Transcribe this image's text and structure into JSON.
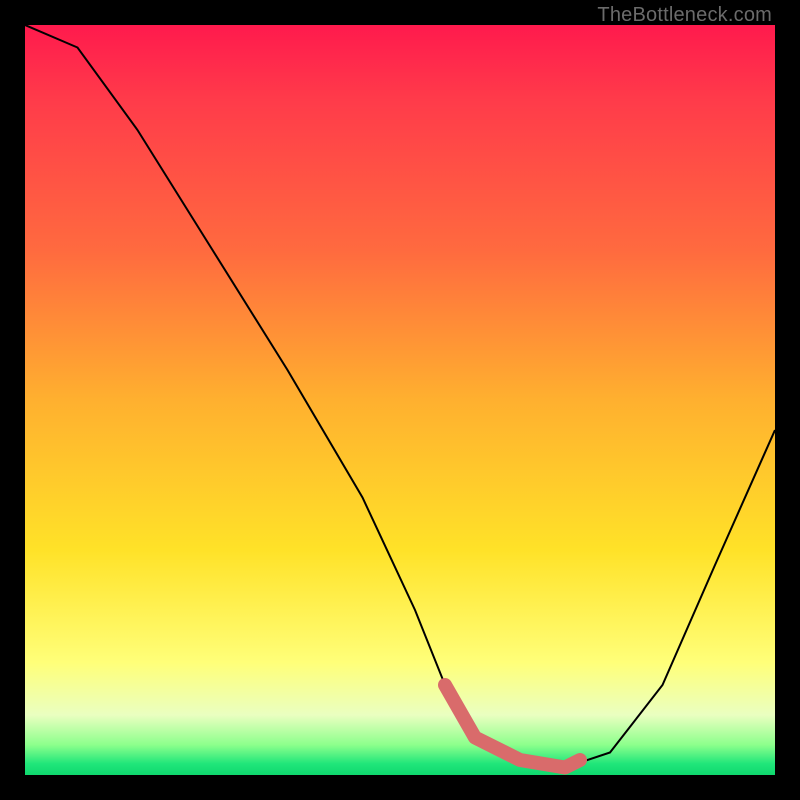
{
  "attribution": "TheBottleneck.com",
  "chart_data": {
    "type": "line",
    "title": "",
    "xlabel": "",
    "ylabel": "",
    "xlim": [
      0,
      100
    ],
    "ylim": [
      0,
      100
    ],
    "series": [
      {
        "name": "bottleneck-curve",
        "x": [
          0,
          7,
          15,
          25,
          35,
          45,
          52,
          56,
          60,
          66,
          72,
          78,
          85,
          92,
          100
        ],
        "values": [
          100,
          97,
          86,
          70,
          54,
          37,
          22,
          12,
          5,
          2,
          1,
          3,
          12,
          28,
          46
        ]
      },
      {
        "name": "highlighted-range",
        "x": [
          56,
          60,
          66,
          72,
          74
        ],
        "values": [
          12,
          5,
          2,
          1,
          2
        ]
      }
    ],
    "gradient_bands": [
      {
        "color": "#ff1a4d",
        "stop": 0
      },
      {
        "color": "#ff6a3f",
        "stop": 30
      },
      {
        "color": "#ffe228",
        "stop": 70
      },
      {
        "color": "#ffff79",
        "stop": 85
      },
      {
        "color": "#20e67a",
        "stop": 98
      },
      {
        "color": "#0fd86e",
        "stop": 100
      }
    ],
    "highlight_color": "#d96b6b",
    "curve_color": "#000000"
  }
}
